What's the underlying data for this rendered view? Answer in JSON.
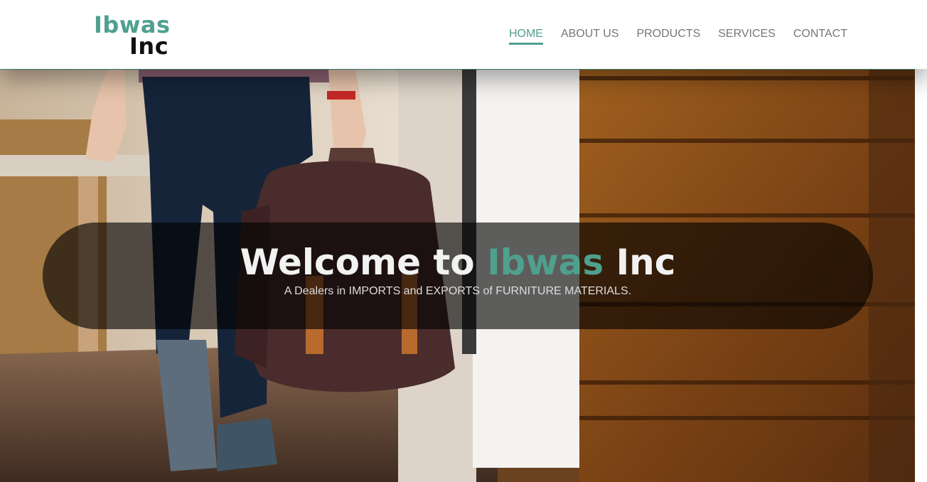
{
  "brand": {
    "line1": "Ibwas",
    "line2": "Inc",
    "accent_color": "#4fa08e"
  },
  "nav": {
    "items": [
      {
        "label": "HOME",
        "active": true
      },
      {
        "label": "ABOUT US"
      },
      {
        "label": "PRODUCTS"
      },
      {
        "label": "SERVICES"
      },
      {
        "label": "CONTACT"
      }
    ]
  },
  "hero": {
    "title_prefix": "Welcome to ",
    "title_accent": "Ibwas",
    "title_suffix": " Inc",
    "subtitle": "A Dealers in IMPORTS and EXPORTS of FURNITURE MATERIALS."
  }
}
